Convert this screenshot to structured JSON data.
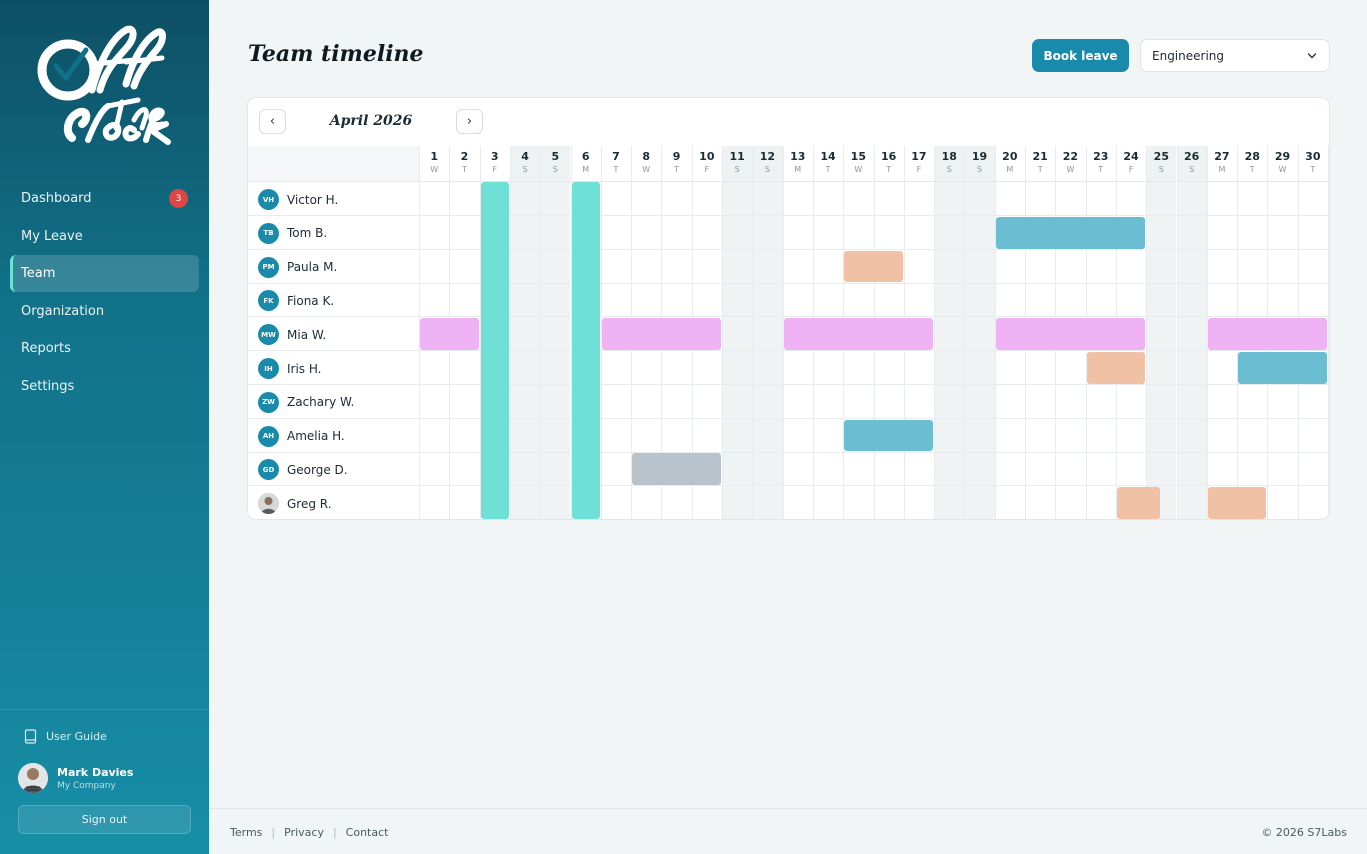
{
  "app": {
    "logo_text": "Off The Clock"
  },
  "nav": {
    "items": [
      {
        "label": "Dashboard",
        "badge": "3"
      },
      {
        "label": "My Leave"
      },
      {
        "label": "Team",
        "active": true
      },
      {
        "label": "Organization"
      },
      {
        "label": "Reports"
      },
      {
        "label": "Settings"
      }
    ]
  },
  "sidebar_footer": {
    "user_guide": "User Guide",
    "user_name": "Mark Davies",
    "user_company": "My Company",
    "sign_out": "Sign out"
  },
  "header": {
    "title": "Team timeline",
    "book_leave": "Book leave",
    "department": "Engineering"
  },
  "timeline": {
    "month": "April 2026",
    "prev_glyph": "‹",
    "next_glyph": "›",
    "days": [
      {
        "n": "1",
        "d": "W"
      },
      {
        "n": "2",
        "d": "T"
      },
      {
        "n": "3",
        "d": "F"
      },
      {
        "n": "4",
        "d": "S",
        "we": true
      },
      {
        "n": "5",
        "d": "S",
        "we": true
      },
      {
        "n": "6",
        "d": "M"
      },
      {
        "n": "7",
        "d": "T"
      },
      {
        "n": "8",
        "d": "W"
      },
      {
        "n": "9",
        "d": "T"
      },
      {
        "n": "10",
        "d": "F"
      },
      {
        "n": "11",
        "d": "S",
        "we": true
      },
      {
        "n": "12",
        "d": "S",
        "we": true
      },
      {
        "n": "13",
        "d": "M"
      },
      {
        "n": "14",
        "d": "T"
      },
      {
        "n": "15",
        "d": "W"
      },
      {
        "n": "16",
        "d": "T"
      },
      {
        "n": "17",
        "d": "F"
      },
      {
        "n": "18",
        "d": "S",
        "we": true
      },
      {
        "n": "19",
        "d": "S",
        "we": true
      },
      {
        "n": "20",
        "d": "M"
      },
      {
        "n": "21",
        "d": "T"
      },
      {
        "n": "22",
        "d": "W"
      },
      {
        "n": "23",
        "d": "T"
      },
      {
        "n": "24",
        "d": "F"
      },
      {
        "n": "25",
        "d": "S",
        "we": true
      },
      {
        "n": "26",
        "d": "S",
        "we": true
      },
      {
        "n": "27",
        "d": "M"
      },
      {
        "n": "28",
        "d": "T"
      },
      {
        "n": "29",
        "d": "W"
      },
      {
        "n": "30",
        "d": "T"
      }
    ],
    "members": [
      {
        "initials": "VH",
        "name": "Victor H."
      },
      {
        "initials": "TB",
        "name": "Tom B."
      },
      {
        "initials": "PM",
        "name": "Paula M."
      },
      {
        "initials": "FK",
        "name": "Fiona K."
      },
      {
        "initials": "MW",
        "name": "Mia W."
      },
      {
        "initials": "IH",
        "name": "Iris H."
      },
      {
        "initials": "ZW",
        "name": "Zachary W."
      },
      {
        "initials": "AH",
        "name": "Amelia H."
      },
      {
        "initials": "GD",
        "name": "George D."
      },
      {
        "initials": "",
        "name": "Greg R.",
        "photo": true
      }
    ],
    "holidays": [
      3,
      6
    ],
    "colors": {
      "holiday": "#6fe0d5",
      "blue": "#6bbdd2",
      "peach": "#f1c1a5",
      "pink": "#eeb2f5",
      "gray": "#b8c2ca"
    },
    "leaves": [
      {
        "row": 1,
        "start": 20,
        "end": 24,
        "color": "blue"
      },
      {
        "row": 2,
        "start": 15,
        "end": 16,
        "color": "peach"
      },
      {
        "row": 4,
        "start": 1,
        "end": 2,
        "color": "pink"
      },
      {
        "row": 4,
        "start": 7,
        "end": 10,
        "color": "pink"
      },
      {
        "row": 4,
        "start": 13,
        "end": 17,
        "color": "pink"
      },
      {
        "row": 4,
        "start": 20,
        "end": 24,
        "color": "pink"
      },
      {
        "row": 4,
        "start": 27,
        "end": 30,
        "color": "pink"
      },
      {
        "row": 5,
        "start": 23,
        "end": 24,
        "color": "peach"
      },
      {
        "row": 5,
        "start": 28,
        "end": 30,
        "color": "blue"
      },
      {
        "row": 7,
        "start": 15,
        "end": 17,
        "color": "blue"
      },
      {
        "row": 8,
        "start": 8,
        "end": 10,
        "color": "gray"
      },
      {
        "row": 9,
        "start": 24,
        "end": 24.5,
        "color": "peach"
      },
      {
        "row": 9,
        "start": 27,
        "end": 28,
        "color": "peach"
      }
    ]
  },
  "footer": {
    "links": [
      "Terms",
      "Privacy",
      "Contact"
    ],
    "copyright": "© 2026 S7Labs"
  }
}
